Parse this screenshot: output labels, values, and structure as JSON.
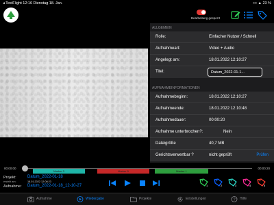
{
  "status_bar": {
    "left": "◂ TestFlight  12:16  Dienstag 18. Jan.",
    "right": "•••  ▲  23 %"
  },
  "header": {
    "lock_label": "Bearbeitung gesperrt",
    "lock_on": true,
    "accent_color": "#30d158"
  },
  "panel": {
    "general_header": "ALLGEMEIN",
    "general_rows": [
      {
        "label": "Rolle:",
        "value": "Einfacher Nutzer / Schnell"
      },
      {
        "label": "Aufnahmeart:",
        "value": "Video + Audio"
      },
      {
        "label": "Angelegt am:",
        "value": "18.01.2022 12:10:27"
      }
    ],
    "title_label": "Titel:",
    "title_value": "Datum_2022-01-1...",
    "info_header": "AUFNAHMEINFORMATIONEN",
    "info_rows": [
      {
        "label": "Aufnahmebeginn:",
        "value": "18.01.2022 12:10:27"
      },
      {
        "label": "Aufnahmeende:",
        "value": "18.01.2022 12:10:48"
      },
      {
        "label": "Aufnahmedauer:",
        "value": "00:00:20"
      },
      {
        "label": "Aufnahme unterbrochen?:",
        "value": "Nein"
      },
      {
        "label": "Dateigröße",
        "value": "40,7 MB"
      }
    ],
    "court_label": "Gerichtsverwertbar ?",
    "court_value": "nicht geprüft",
    "check_label": "Prüfen"
  },
  "timeline": {
    "start": "00:00:00",
    "end": "00:00:20",
    "position": 0.0,
    "markers": [
      {
        "label": "Marker 3",
        "color": "#1fb5a8"
      },
      {
        "label": "Marker 5",
        "color": "#c62828"
      },
      {
        "label": "Marker 1",
        "color": "#2e9e3e"
      }
    ]
  },
  "player": {
    "project_label": "Projekt:",
    "project_value": "Datum_2022-01-18",
    "created_label": "erstellt am:",
    "created_value": "18.01.2022 12:08:23",
    "recording_label": "Aufnahme:",
    "recording_value": "Datum_2022-01-18_12-10-27",
    "marker_buttons": [
      {
        "num": "1",
        "color": "#30d158"
      },
      {
        "num": "2",
        "color": "#0a60ff"
      },
      {
        "num": "3",
        "color": "#2ad4c4"
      },
      {
        "num": "4",
        "color": "#ff2d9a"
      },
      {
        "num": "5",
        "color": "#ff3b30"
      }
    ]
  },
  "tabs": [
    {
      "label": "Aufnahme",
      "icon": "camera-icon",
      "active": false
    },
    {
      "label": "Wiedergabe",
      "icon": "play-circle-icon",
      "active": true
    },
    {
      "label": "Projekte",
      "icon": "folder-icon",
      "active": false
    },
    {
      "label": "Einstellungen",
      "icon": "gear-icon",
      "active": false
    },
    {
      "label": "Hilfe",
      "icon": "question-icon",
      "active": false
    }
  ]
}
